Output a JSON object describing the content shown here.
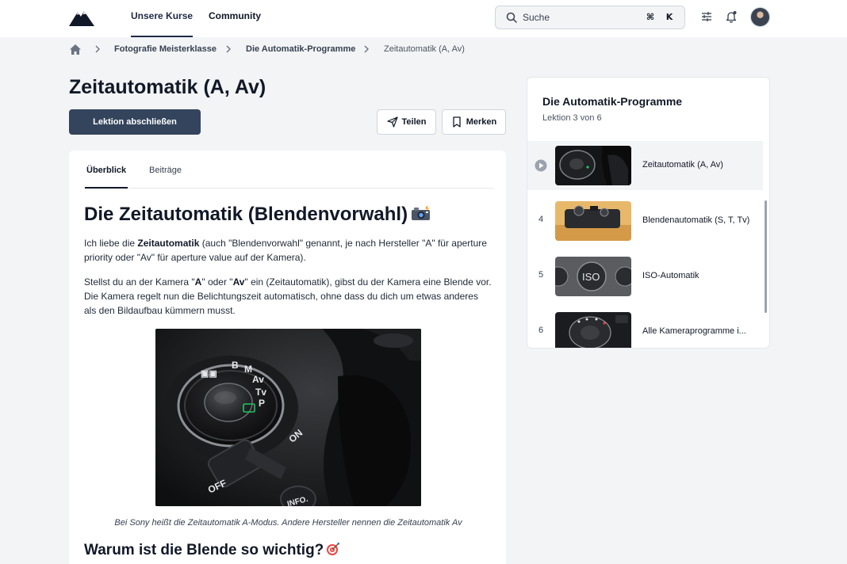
{
  "header": {
    "nav": [
      {
        "label": "Unsere Kurse",
        "active": true
      },
      {
        "label": "Community",
        "active": false
      }
    ],
    "search": {
      "placeholder": "Suche",
      "shortcut_keys": [
        "⌘",
        "K"
      ]
    },
    "icons": [
      "mountain-logo",
      "sliders-icon",
      "bell-icon",
      "user-avatar"
    ]
  },
  "breadcrumb": {
    "items": [
      "Fotografie Meisterklasse",
      "Die Automatik-Programme",
      "Zeitautomatik (A, Av)"
    ]
  },
  "page": {
    "title": "Zeitautomatik (A, Av)",
    "complete_button": "Lektion abschließen",
    "share_button": "Teilen",
    "bookmark_button": "Merken"
  },
  "content": {
    "tabs": [
      {
        "label": "Überblick",
        "active": true
      },
      {
        "label": "Beiträge",
        "active": false
      }
    ],
    "heading": "Die Zeitautomatik (Blendenvorwahl)",
    "para1": {
      "pre": "Ich liebe die ",
      "bold": "Zeitautomatik",
      "post": " (auch \"Blendenvorwahl\" genannt, je nach Hersteller \"A\" für aperture priority oder \"Av\" für aperture value auf der Kamera)."
    },
    "para2": {
      "p1": "Stellst du an der Kamera \"",
      "b1": "A",
      "p2": "\" oder \"",
      "b2": "Av",
      "p3": "\" ein (Zeitautomatik), gibst du der Kamera eine Blende vor. Die Kamera regelt nun die Belichtungszeit automatisch, ohne dass du dich um etwas anderes als den Bildaufbau kümmern musst."
    },
    "image_dial_labels": [
      "B",
      "M",
      "Av",
      "Tv",
      "P",
      "OFF",
      "ON",
      "INFO."
    ],
    "caption": "Bei Sony heißt die Zeitautomatik A-Modus. Andere Hersteller nennen die Zeitautomatik Av",
    "heading2": "Warum ist die Blende so wichtig?"
  },
  "sidebar": {
    "title": "Die Automatik-Programme",
    "subtitle": "Lektion 3 von 6",
    "lessons": [
      {
        "number": "",
        "label": "Zeitautomatik (A, Av)",
        "active": true,
        "thumbnail": "camera-mode-dial"
      },
      {
        "number": "4",
        "label": "Blendenautomatik (S, T, Tv)",
        "active": false,
        "thumbnail": "camera-top-view"
      },
      {
        "number": "5",
        "label": "ISO-Automatik",
        "active": false,
        "thumbnail": "iso-button"
      },
      {
        "number": "6",
        "label": "Alle Kameraprogramme i...",
        "active": false,
        "thumbnail": "camera-dial-closeup"
      }
    ]
  },
  "colors": {
    "primary_button": "#34445c",
    "background": "#f3f4f6",
    "card": "#ffffff",
    "text": "#111827"
  }
}
